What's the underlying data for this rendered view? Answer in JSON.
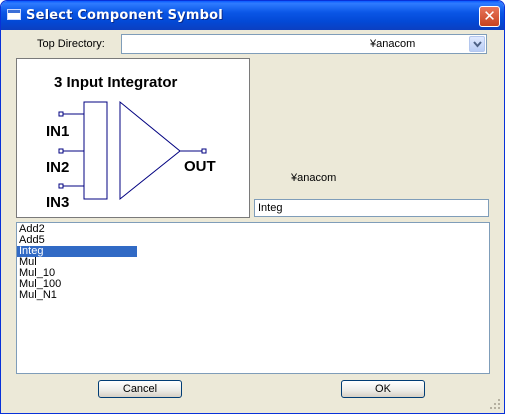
{
  "window": {
    "title": "Select Component Symbol",
    "close_glyph": "✕"
  },
  "top_directory": {
    "label": "Top Directory:",
    "value": "¥anacom"
  },
  "preview": {
    "title": "3 Input Integrator",
    "inputs": [
      "IN1",
      "IN2",
      "IN3"
    ],
    "output": "OUT"
  },
  "directory_path": "¥anacom",
  "component_name": "Integ",
  "components": [
    {
      "label": "Add2",
      "selected": false
    },
    {
      "label": "Add5",
      "selected": false
    },
    {
      "label": "Integ",
      "selected": true
    },
    {
      "label": "Mul",
      "selected": false
    },
    {
      "label": "Mul_10",
      "selected": false
    },
    {
      "label": "Mul_100",
      "selected": false
    },
    {
      "label": "Mul_N1",
      "selected": false
    }
  ],
  "buttons": {
    "cancel": "Cancel",
    "ok": "OK"
  },
  "colors": {
    "titlebar": "#0a56e6",
    "selection": "#316ac5",
    "dialog_bg": "#ece9d8",
    "close": "#d4502e"
  },
  "icons": {
    "app": "window-icon",
    "close": "close-icon",
    "dropdown": "chevron-down-icon",
    "grip": "resize-grip-icon"
  }
}
